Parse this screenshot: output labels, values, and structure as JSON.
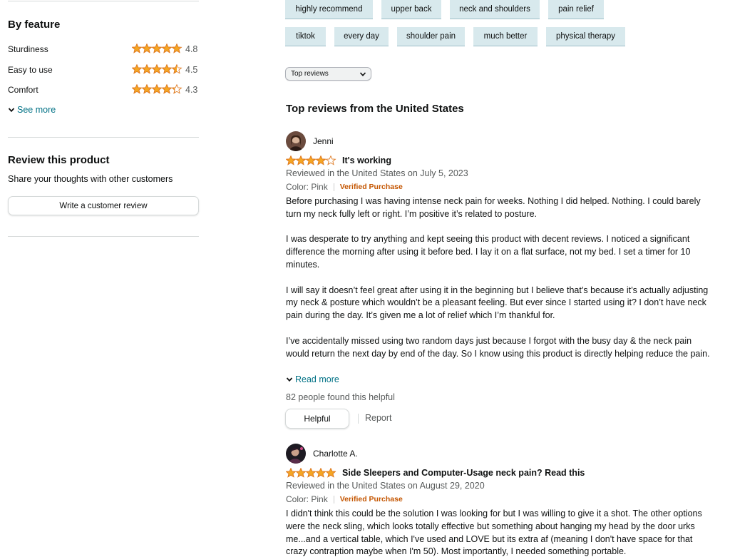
{
  "sidebar": {
    "by_feature_title": "By feature",
    "features": [
      {
        "name": "Sturdiness",
        "rating": 4.8,
        "value": "4.8"
      },
      {
        "name": "Easy to use",
        "rating": 4.5,
        "value": "4.5"
      },
      {
        "name": "Comfort",
        "rating": 4.3,
        "value": "4.3"
      }
    ],
    "see_more": "See more",
    "review_title": "Review this product",
    "share_text": "Share your thoughts with other customers",
    "write_review": "Write a customer review"
  },
  "chips": [
    "highly recommend",
    "upper back",
    "neck and shoulders",
    "pain relief",
    "tiktok",
    "every day",
    "shoulder pain",
    "much better",
    "physical therapy"
  ],
  "sort": {
    "selected": "Top reviews"
  },
  "reviews_heading": "Top reviews from the United States",
  "reviews": [
    {
      "name": "Jenni",
      "rating": 4,
      "title": "It's working",
      "reviewed": "Reviewed in the United States on July 5, 2023",
      "color": "Color: Pink",
      "verified": "Verified Purchase",
      "paragraphs": [
        "Before purchasing I was having intense neck pain for weeks. Nothing I did helped. Nothing. I could barely turn my neck fully left or right. I’m positive it’s related to posture.",
        "I was desperate to try anything and kept seeing this product with decent reviews. I noticed a significant difference the morning after using it before bed. I lay it on a flat surface, not my bed. I set a timer for 10 minutes.",
        "I will say it doesn’t feel great after using it in the beginning but I believe that’s because it’s actually adjusting my neck & posture which wouldn’t be a pleasant feeling. But ever since I started using it? I don’t have neck pain during the day. It’s given me a lot of relief which I’m thankful for.",
        "I’ve accidentally missed using two random days just because I forgot with the busy day & the neck pain would return the next day by end of the day. So I know using this product is directly helping reduce the pain."
      ],
      "read_more": "Read more",
      "helpful_count": "82 people found this helpful",
      "helpful_btn": "Helpful",
      "report": "Report"
    },
    {
      "name": "Charlotte A.",
      "rating": 5,
      "title": "Side Sleepers and Computer-Usage neck pain? Read this",
      "reviewed": "Reviewed in the United States on August 29, 2020",
      "color": "Color: Pink",
      "verified": "Verified Purchase",
      "paragraphs": [
        "I didn't think this could be the solution I was looking for but I was willing to give it a shot. The other options were the neck sling, which looks totally effective but something about hanging my head by the door urks me...and a vertical table, which I've used and LOVE but its extra af (meaning I don't have space for that crazy contraption maybe when I'm 50). Most importantly, I needed something portable."
      ]
    }
  ],
  "colors": {
    "star": "#f5a623",
    "link": "#007185",
    "verified": "#c45500",
    "chip_bg": "#d8e9ed"
  }
}
